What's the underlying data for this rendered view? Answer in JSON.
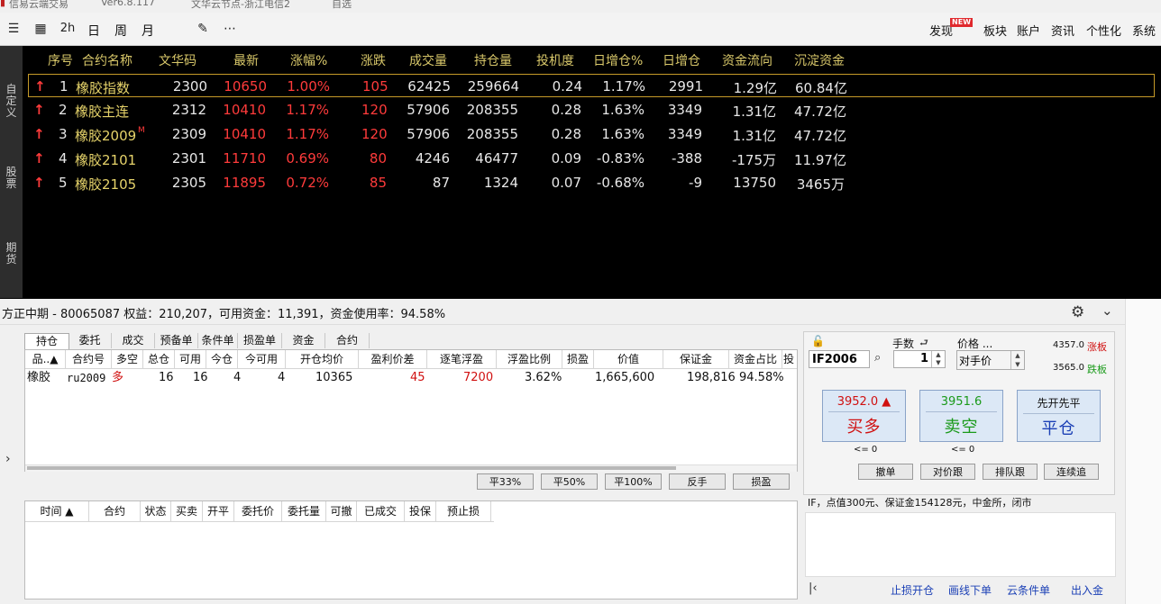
{
  "titlebar": {
    "app": "信易云端交易",
    "version": "Ver6.8.117",
    "node": "文华云节点-浙江电信2",
    "self_select": "自选"
  },
  "toolbar": {
    "left": [
      {
        "name": "list-icon",
        "glyph": "☰"
      },
      {
        "name": "grid-icon",
        "glyph": "▦"
      },
      {
        "name": "chart-2h-icon",
        "text": "2h"
      },
      {
        "name": "day-button",
        "text": "日"
      },
      {
        "name": "week-button",
        "text": "周"
      },
      {
        "name": "month-button",
        "text": "月"
      },
      {
        "name": "draw-icon",
        "glyph": "✎"
      },
      {
        "name": "more-icon",
        "text": "⋯"
      }
    ],
    "right": [
      "发现",
      "板块",
      "账户",
      "资讯",
      "个性化",
      "系统"
    ],
    "new_badge": "NEW"
  },
  "sidetabs": [
    "自定义",
    "股票",
    "期货"
  ],
  "quote": {
    "headers": [
      "序号",
      "合约名称",
      "文华码",
      "最新",
      "涨幅%",
      "涨跌",
      "成交量",
      "持仓量",
      "投机度",
      "日增仓%",
      "日增仓",
      "资金流向",
      "沉淀资金"
    ],
    "rows": [
      {
        "idx": "1",
        "name": "橡胶指数",
        "mtag": "",
        "code": "2300",
        "last": "10650",
        "pct": "1.00%",
        "chg": "105",
        "vol": "62425",
        "oi": "259664",
        "spec": "0.24",
        "oipct": "1.17%",
        "oichg": "2991",
        "flow": "1.29亿",
        "sink": "60.84亿"
      },
      {
        "idx": "2",
        "name": "橡胶主连",
        "mtag": "",
        "code": "2312",
        "last": "10410",
        "pct": "1.17%",
        "chg": "120",
        "vol": "57906",
        "oi": "208355",
        "spec": "0.28",
        "oipct": "1.63%",
        "oichg": "3349",
        "flow": "1.31亿",
        "sink": "47.72亿"
      },
      {
        "idx": "3",
        "name": "橡胶2009",
        "mtag": "M",
        "code": "2309",
        "last": "10410",
        "pct": "1.17%",
        "chg": "120",
        "vol": "57906",
        "oi": "208355",
        "spec": "0.28",
        "oipct": "1.63%",
        "oichg": "3349",
        "flow": "1.31亿",
        "sink": "47.72亿"
      },
      {
        "idx": "4",
        "name": "橡胶2101",
        "mtag": "",
        "code": "2301",
        "last": "11710",
        "pct": "0.69%",
        "chg": "80",
        "vol": "4246",
        "oi": "46477",
        "spec": "0.09",
        "oipct": "-0.83%",
        "oichg": "-388",
        "flow": "-175万",
        "sink": "11.97亿"
      },
      {
        "idx": "5",
        "name": "橡胶2105",
        "mtag": "",
        "code": "2305",
        "last": "11895",
        "pct": "0.72%",
        "chg": "85",
        "vol": "87",
        "oi": "1324",
        "spec": "0.07",
        "oipct": "-0.68%",
        "oichg": "-9",
        "flow": "13750",
        "sink": "3465万"
      }
    ]
  },
  "account": {
    "line": "方正中期 - 80065087  权益：210,207，可用资金：11,391，资金使用率：94.58%"
  },
  "panel_tabs": [
    "持仓",
    "委托",
    "成交",
    "预备单",
    "条件单",
    "损盈单",
    "资金",
    "合约"
  ],
  "positions": {
    "headers": [
      "品..▲",
      "合约号",
      "多空",
      "总仓",
      "可用",
      "今仓",
      "今可用",
      "开仓均价",
      "盈利价差",
      "逐笔浮盈",
      "浮盈比例",
      "损盈",
      "价值",
      "保证金",
      "资金占比",
      "投"
    ],
    "row": {
      "variety": "橡胶",
      "contract": "ru2009",
      "side": "多",
      "total": "16",
      "avail": "16",
      "today": "4",
      "today_avail": "4",
      "open_avg": "10365",
      "profit_diff": "45",
      "float_pnl": "7200",
      "float_ratio": "3.62%",
      "sl": "",
      "value": "1,665,600",
      "margin": "198,816",
      "ratio": "94.58%"
    }
  },
  "pos_buttons": [
    "平33%",
    "平50%",
    "平100%",
    "反手",
    "损盈"
  ],
  "orders": {
    "headers": [
      "时间 ▲",
      "合约",
      "状态",
      "买卖",
      "开平",
      "委托价",
      "委托量",
      "可撤",
      "已成交",
      "投保",
      "预止损"
    ]
  },
  "order_entry": {
    "contract": "IF2006",
    "lots_label": "手数",
    "lots": "1",
    "price_label": "价格 ...",
    "price_value": "对手价",
    "limit_up": "4357.0",
    "limit_up_label": "涨板",
    "limit_down": "3565.0",
    "limit_down_label": "跌板",
    "buy": {
      "price": "3952.0 ▲",
      "label": "买多",
      "sub": "<= 0"
    },
    "sell": {
      "price": "3951.6",
      "label": "卖空",
      "sub": "<= 0"
    },
    "close": {
      "price": "先开先平",
      "label": "平仓"
    },
    "small_buttons": [
      "撤单",
      "对价跟",
      "排队跟",
      "连续追"
    ],
    "info": "IF，点值300元、保证金154128元，中金所，闭市"
  },
  "bottom_links": [
    "止损开仓",
    "画线下单",
    "云条件单",
    "出入金"
  ],
  "colors": {
    "accent_red": "#ff3b3b",
    "quote_yellow": "#e6d36a",
    "green": "#1a9a1a"
  }
}
